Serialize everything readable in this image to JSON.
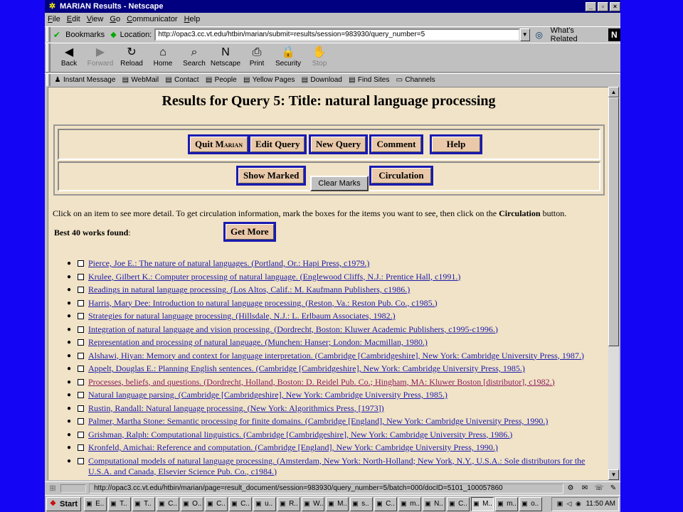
{
  "window": {
    "title": "MARIAN Results - Netscape",
    "controls": [
      "_",
      "▫",
      "×"
    ]
  },
  "menu": [
    "File",
    "Edit",
    "View",
    "Go",
    "Communicator",
    "Help"
  ],
  "location_bar": {
    "bookmarks_label": "Bookmarks",
    "location_label": "Location:",
    "url": "http://opac3.cc.vt.edu/htbin/marian/submit=results/session=983930/query_number=5",
    "whats_related_label": "What's Related"
  },
  "nav_toolbar": [
    {
      "label": "Back",
      "icon": "back-arrow-icon",
      "glyph": "◀",
      "disabled": false
    },
    {
      "label": "Forward",
      "icon": "forward-arrow-icon",
      "glyph": "▶",
      "disabled": true
    },
    {
      "label": "Reload",
      "icon": "reload-icon",
      "glyph": "↻",
      "disabled": false
    },
    {
      "label": "Home",
      "icon": "home-icon",
      "glyph": "⌂",
      "disabled": false
    },
    {
      "label": "Search",
      "icon": "search-icon",
      "glyph": "⌕",
      "disabled": false
    },
    {
      "label": "Netscape",
      "icon": "netscape-icon",
      "glyph": "N",
      "disabled": false
    },
    {
      "label": "Print",
      "icon": "printer-icon",
      "glyph": "⎙",
      "disabled": false
    },
    {
      "label": "Security",
      "icon": "lock-icon",
      "glyph": "🔒",
      "disabled": false
    },
    {
      "label": "Stop",
      "icon": "stop-icon",
      "glyph": "✋",
      "disabled": true
    }
  ],
  "personal_toolbar": [
    {
      "label": "Instant Message",
      "icon": "person-icon",
      "glyph": "♟"
    },
    {
      "label": "WebMail",
      "icon": "bookmark-page-icon",
      "glyph": "▤"
    },
    {
      "label": "Contact",
      "icon": "bookmark-page-icon",
      "glyph": "▤"
    },
    {
      "label": "People",
      "icon": "bookmark-page-icon",
      "glyph": "▤"
    },
    {
      "label": "Yellow Pages",
      "icon": "bookmark-page-icon",
      "glyph": "▤"
    },
    {
      "label": "Download",
      "icon": "bookmark-page-icon",
      "glyph": "▤"
    },
    {
      "label": "Find Sites",
      "icon": "bookmark-page-icon",
      "glyph": "▤"
    },
    {
      "label": "Channels",
      "icon": "folder-icon",
      "glyph": "▭"
    }
  ],
  "page": {
    "heading": "Results for Query 5: Title: natural language processing",
    "buttons_row1": {
      "quit_prefix": "Quit M",
      "quit_smallcaps": "ARIAN",
      "edit_query": "Edit Query",
      "new_query": "New Query",
      "comment": "Comment",
      "help": "Help"
    },
    "buttons_row2": {
      "show_marked": "Show Marked",
      "clear_marks": "Clear Marks",
      "circulation": "Circulation"
    },
    "instructions_before": "Click on an item to see more detail. To get circulation information, mark the boxes for the items you want to see, then click on the ",
    "instructions_bold": "Circulation",
    "instructions_after": " button.",
    "found_bold": "Best 40 works found",
    "found_suffix": ":",
    "get_more": "Get More",
    "results": [
      {
        "text": "Pierce, Joe E.: The nature of natural languages. (Portland, Or.: Hapi Press, c1979.)",
        "visited": false
      },
      {
        "text": "Krulee, Gilbert K.: Computer processing of natural language. (Englewood Cliffs, N.J.: Prentice Hall, c1991.)",
        "visited": false
      },
      {
        "text": "Readings in natural language processing. (Los Altos, Calif.: M. Kaufmann Publishers, c1986.)",
        "visited": false
      },
      {
        "text": "Harris, Mary Dee: Introduction to natural language processing. (Reston, Va.: Reston Pub. Co., c1985.)",
        "visited": false
      },
      {
        "text": "Strategies for natural language processing. (Hillsdale, N.J.: L. Erlbaum Associates, 1982.)",
        "visited": false
      },
      {
        "text": "Integration of natural language and vision processing. (Dordrecht, Boston: Kluwer Academic Publishers, c1995-c1996.)",
        "visited": false
      },
      {
        "text": "Representation and processing of natural language. (Munchen: Hanser; London: Macmillan, 1980.)",
        "visited": false
      },
      {
        "text": "Alshawi, Hiyan: Memory and context for language interpretation. (Cambridge [Cambridgeshire], New York: Cambridge University Press, 1987.)",
        "visited": false
      },
      {
        "text": "Appelt, Douglas E.: Planning English sentences. (Cambridge [Cambridgeshire], New York: Cambridge University Press, 1985.)",
        "visited": false
      },
      {
        "text": "Processes, beliefs, and questions. (Dordrecht, Holland, Boston: D. Reidel Pub. Co.; Hingham, MA: Kluwer Boston [distributor], c1982.)",
        "visited": true
      },
      {
        "text": "Natural language parsing. (Cambridge [Cambridgeshire], New York: Cambridge University Press, 1985.)",
        "visited": false
      },
      {
        "text": "Rustin, Randall: Natural language processing. (New York: Algorithmics Press, [1973])",
        "visited": false
      },
      {
        "text": "Palmer, Martha Stone: Semantic processing for finite domains. (Cambridge [England], New York: Cambridge University Press, 1990.)",
        "visited": false
      },
      {
        "text": "Grishman, Ralph: Computational linguistics. (Cambridge [Cambridgeshire], New York: Cambridge University Press, 1986.)",
        "visited": false
      },
      {
        "text": "Kronfeld, Amichai: Reference and computation. (Cambridge [England], New York: Cambridge University Press, 1990.)",
        "visited": false
      },
      {
        "text": "Computational models of natural language processing. (Amsterdam, New York: North-Holland; New York, N.Y., U.S.A.: Sole distributors for the U.S.A. and Canada, Elsevier Science Pub. Co., c1984.)",
        "visited": false,
        "wrap": true
      }
    ]
  },
  "status_bar": {
    "text": "http://opac3.cc.vt.edu/htbin/marian/page=result_document/session=983930/query_number=5/batch=000/docID=5101_100057860"
  },
  "taskbar": {
    "start_label": "Start",
    "tasks": [
      "E..",
      "T..",
      "T..",
      "C..",
      "O..",
      "C..",
      "C..",
      "u..",
      "R..",
      "W..",
      "M..",
      "s..",
      "C..",
      "m..",
      "N..",
      "C..",
      "M..",
      "m..",
      "o.."
    ],
    "active_task_index": 16,
    "clock": "11:50 AM"
  },
  "colors": {
    "desktop": "#1405f4",
    "content_bg": "#f1e3c7",
    "link": "#1a1aa8",
    "visited_link": "#8b1a5a",
    "button_border": "#1a1ab0",
    "button_face": "#e9c9a9"
  }
}
